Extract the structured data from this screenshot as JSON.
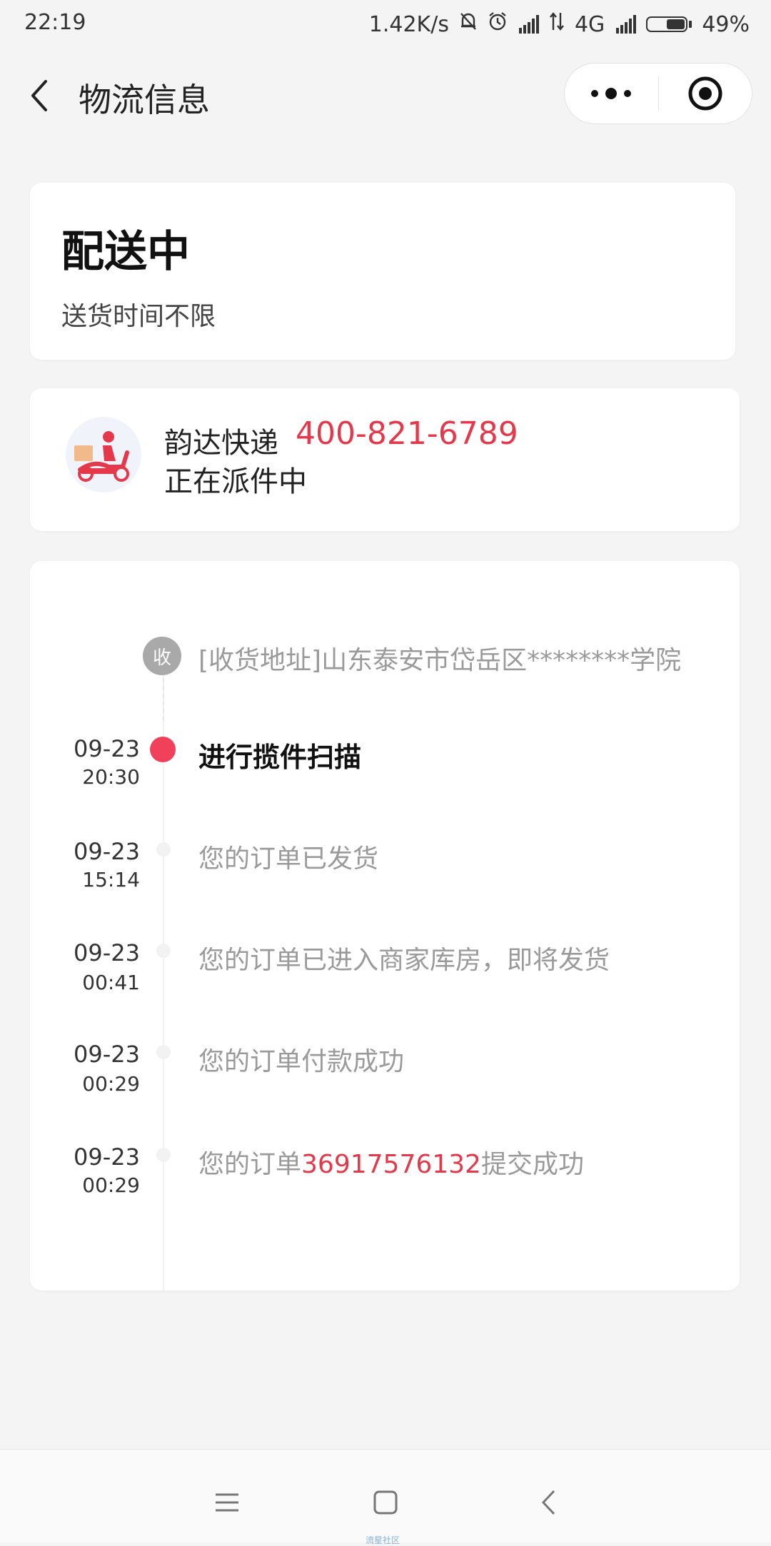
{
  "status_bar": {
    "time": "22:19",
    "speed": "1.42K/s",
    "network": "4G",
    "battery": "49%",
    "icons": [
      "bell-muted-icon",
      "alarm-icon",
      "signal-icon",
      "data-arrows-icon",
      "signal-icon",
      "battery-icon"
    ]
  },
  "nav": {
    "title": "物流信息",
    "back_icon": "chevron-left-icon",
    "more_icon": "more-dots-icon",
    "close_icon": "target-icon"
  },
  "delivery_status": {
    "title": "配送中",
    "subtitle": "送货时间不限"
  },
  "courier": {
    "name": "韵达快递",
    "phone": "400-821-6789",
    "state": "正在派件中",
    "avatar_icon": "delivery-scooter-icon"
  },
  "timeline": {
    "address_label": "收",
    "address": "[收货地址]山东泰安市岱岳区********学院",
    "entries": [
      {
        "date": "09-23",
        "time": "20:30",
        "text": "进行揽件扫描",
        "active": true
      },
      {
        "date": "09-23",
        "time": "15:14",
        "text": "您的订单已发货",
        "active": false
      },
      {
        "date": "09-23",
        "time": "00:41",
        "text": "您的订单已进入商家库房，即将发货",
        "active": false
      },
      {
        "date": "09-23",
        "time": "00:29",
        "text": "您的订单付款成功",
        "active": false
      },
      {
        "date": "09-23",
        "time": "00:29",
        "text_prefix": "您的订单",
        "order_number": "36917576132",
        "text_suffix": "提交成功",
        "active": false
      }
    ]
  },
  "bottom_nav": {
    "items": [
      "menu-icon",
      "home-square-icon",
      "back-chevron-icon"
    ],
    "watermark": "流星社区"
  },
  "colors": {
    "accent": "#e5384a",
    "background": "#f4f4f4",
    "card": "#ffffff",
    "muted_text": "#9a9a9a"
  }
}
